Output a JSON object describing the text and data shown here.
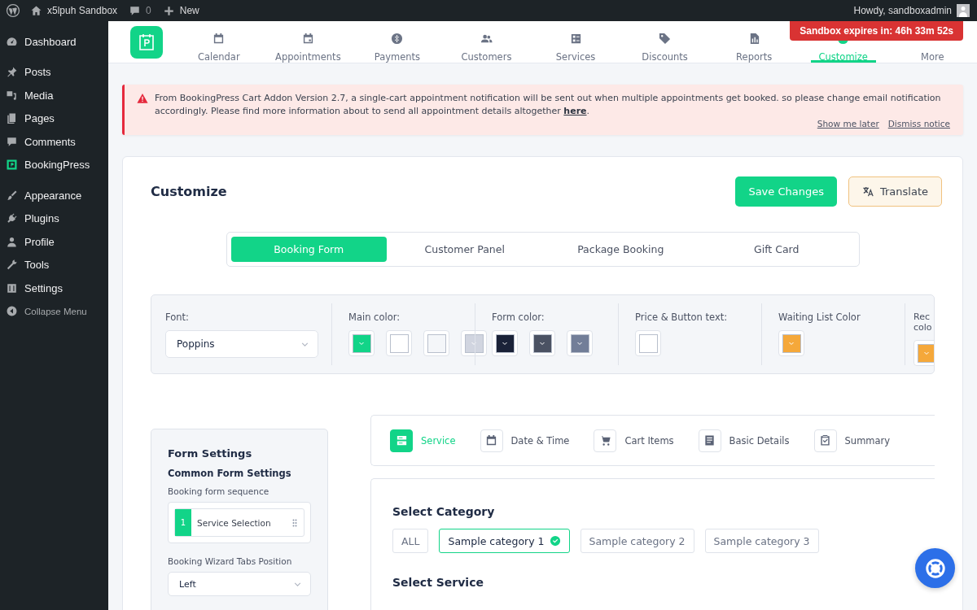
{
  "admin_bar": {
    "site_name": "x5lpuh Sandbox",
    "comment_count": "0",
    "new_label": "New",
    "greeting": "Howdy, sandboxadmin"
  },
  "sidebar": {
    "items": [
      {
        "label": "Dashboard"
      },
      {
        "label": "Posts"
      },
      {
        "label": "Media"
      },
      {
        "label": "Pages"
      },
      {
        "label": "Comments"
      },
      {
        "label": "BookingPress"
      },
      {
        "label": "Appearance"
      },
      {
        "label": "Plugins"
      },
      {
        "label": "Profile"
      },
      {
        "label": "Tools"
      },
      {
        "label": "Settings"
      }
    ],
    "collapse_label": "Collapse Menu"
  },
  "nav": {
    "items": [
      {
        "label": "Calendar",
        "selected": false
      },
      {
        "label": "Appointments",
        "selected": false
      },
      {
        "label": "Payments",
        "selected": false
      },
      {
        "label": "Customers",
        "selected": false
      },
      {
        "label": "Services",
        "selected": false
      },
      {
        "label": "Discounts",
        "selected": false
      },
      {
        "label": "Reports",
        "selected": false
      },
      {
        "label": "Customize",
        "selected": true
      },
      {
        "label": "More",
        "selected": false
      }
    ]
  },
  "sandbox_badge": "Sandbox expires in: 46h 33m 52s",
  "notice": {
    "text": "From BookingPress Cart Addon Version 2.7, a single-cart appointment notification will be sent out when multiple appointments get booked. so please change email notification accordingly. Please find more information about to send all appointment details altogether",
    "link": "here",
    "end": ".",
    "actions": [
      "Show me later",
      "Dismiss notice"
    ]
  },
  "customize": {
    "title": "Customize",
    "save_button": "Save Changes",
    "translate_button": "Translate",
    "tabs": [
      {
        "label": "Booking Form",
        "selected": true
      },
      {
        "label": "Customer Panel",
        "selected": false
      },
      {
        "label": "Package Booking",
        "selected": false
      },
      {
        "label": "Gift Card",
        "selected": false
      }
    ],
    "style_settings": {
      "font": {
        "label": "Font:",
        "value": "Poppins"
      },
      "color_groups": [
        {
          "label": "Main color:",
          "swatches": [
            {
              "color": "#12d488",
              "chevron": true
            },
            {
              "color": "#ffffff",
              "chevron": false
            },
            {
              "color": "#f4f6f9",
              "chevron": false
            },
            {
              "color": "#d1d5e0",
              "chevron": true
            }
          ]
        },
        {
          "label": "Form color:",
          "swatches": [
            {
              "color": "#1a2238",
              "chevron": true
            },
            {
              "color": "#4b5263",
              "chevron": true
            },
            {
              "color": "#727e98",
              "chevron": true
            }
          ]
        },
        {
          "label": "Price & Button text:",
          "swatches": [
            {
              "color": "#ffffff",
              "chevron": false
            }
          ]
        },
        {
          "label": "Waiting List Color",
          "swatches": [
            {
              "color": "#f5a83a",
              "chevron": true
            }
          ]
        },
        {
          "label": "Rec colo",
          "swatches": [
            {
              "color": "#f5a83a",
              "chevron": true
            }
          ]
        }
      ]
    },
    "form_settings": {
      "title": "Form Settings",
      "subtitle": "Common Form Settings",
      "sequence_label": "Booking form sequence",
      "sequence_items": [
        {
          "number": "1",
          "label": "Service Selection"
        }
      ],
      "tabs_position_label": "Booking Wizard Tabs Position",
      "tabs_position_value": "Left"
    },
    "steps": [
      {
        "label": "Service",
        "selected": true
      },
      {
        "label": "Date & Time",
        "selected": false
      },
      {
        "label": "Cart Items",
        "selected": false
      },
      {
        "label": "Basic Details",
        "selected": false
      },
      {
        "label": "Summary",
        "selected": false
      }
    ],
    "category": {
      "title": "Select Category",
      "chips": [
        {
          "label": "ALL",
          "selected": false
        },
        {
          "label": "Sample category 1",
          "selected": true
        },
        {
          "label": "Sample category 2",
          "selected": false
        },
        {
          "label": "Sample category 3",
          "selected": false
        }
      ]
    },
    "service_title": "Select Service"
  }
}
